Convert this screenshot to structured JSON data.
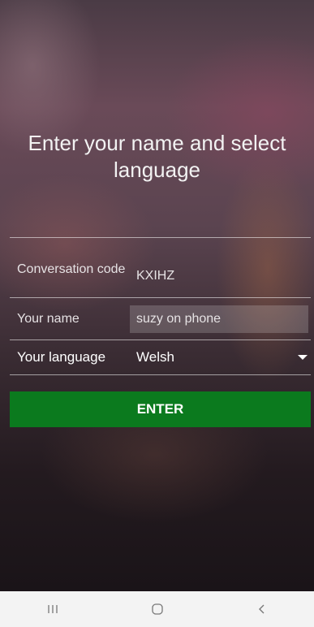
{
  "page": {
    "title": "Enter your name and select language"
  },
  "form": {
    "code_label": "Conversation code",
    "code_value": "KXIHZ",
    "name_label": "Your name",
    "name_value": "suzy on phone",
    "language_label": "Your language",
    "language_value": "Welsh"
  },
  "actions": {
    "enter_label": "ENTER"
  },
  "colors": {
    "enter_button": "#0b7a1e",
    "nav_background": "#f3f3f3"
  },
  "navbar": {
    "icons": [
      "recent-apps-icon",
      "home-icon",
      "back-icon"
    ]
  }
}
